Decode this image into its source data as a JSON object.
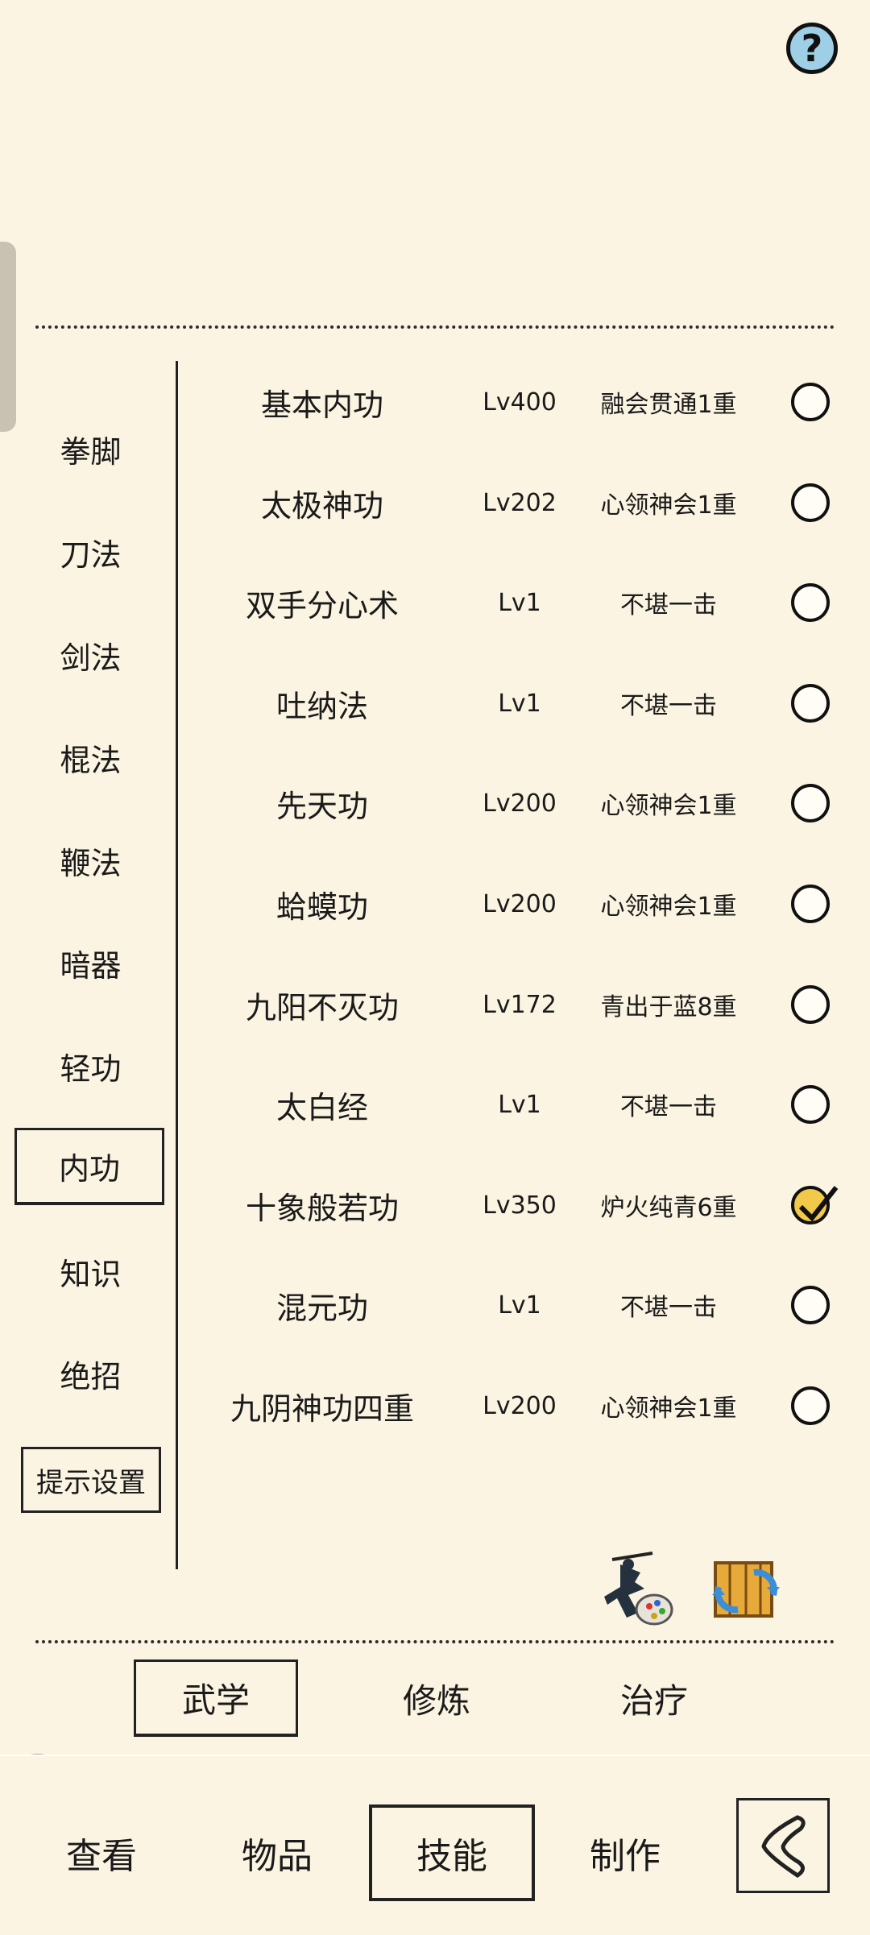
{
  "header": {
    "help_icon": "question-mark-icon",
    "help_label": "?"
  },
  "categories": [
    {
      "label": "拳脚"
    },
    {
      "label": "刀法"
    },
    {
      "label": "剑法"
    },
    {
      "label": "棍法"
    },
    {
      "label": "鞭法"
    },
    {
      "label": "暗器"
    },
    {
      "label": "轻功"
    },
    {
      "label": "内功",
      "selected": true
    },
    {
      "label": "知识"
    },
    {
      "label": "绝招"
    }
  ],
  "tip_settings_label": "提示设置",
  "skills": [
    {
      "name": "基本内功",
      "level": "Lv400",
      "rank": "融会贯通1重",
      "checked": false
    },
    {
      "name": "太极神功",
      "level": "Lv202",
      "rank": "心领神会1重",
      "checked": false
    },
    {
      "name": "双手分心术",
      "level": "Lv1",
      "rank": "不堪一击",
      "checked": false
    },
    {
      "name": "吐纳法",
      "level": "Lv1",
      "rank": "不堪一击",
      "checked": false
    },
    {
      "name": "先天功",
      "level": "Lv200",
      "rank": "心领神会1重",
      "checked": false
    },
    {
      "name": "蛤蟆功",
      "level": "Lv200",
      "rank": "心领神会1重",
      "checked": false
    },
    {
      "name": "九阳不灭功",
      "level": "Lv172",
      "rank": "青出于蓝8重",
      "checked": false
    },
    {
      "name": "太白经",
      "level": "Lv1",
      "rank": "不堪一击",
      "checked": false
    },
    {
      "name": "十象般若功",
      "level": "Lv350",
      "rank": "炉火纯青6重",
      "checked": true
    },
    {
      "name": "混元功",
      "level": "Lv1",
      "rank": "不堪一击",
      "checked": false
    },
    {
      "name": "九阴神功四重",
      "level": "Lv200",
      "rank": "心领神会1重",
      "checked": false
    }
  ],
  "action_icons": [
    "swordsman-palette-icon",
    "refresh-scroll-icon"
  ],
  "sub_tabs": [
    {
      "label": "武学",
      "selected": true
    },
    {
      "label": "修炼"
    },
    {
      "label": "治疗"
    }
  ],
  "bottom_nav": [
    {
      "label": "查看"
    },
    {
      "label": "物品"
    },
    {
      "label": "技能",
      "selected": true
    },
    {
      "label": "制作"
    }
  ],
  "back_icon": "back-arrow-icon",
  "colors": {
    "background": "#fbf4e2",
    "check_on": "#f3c94a",
    "help_bg": "#9ecfe6"
  }
}
